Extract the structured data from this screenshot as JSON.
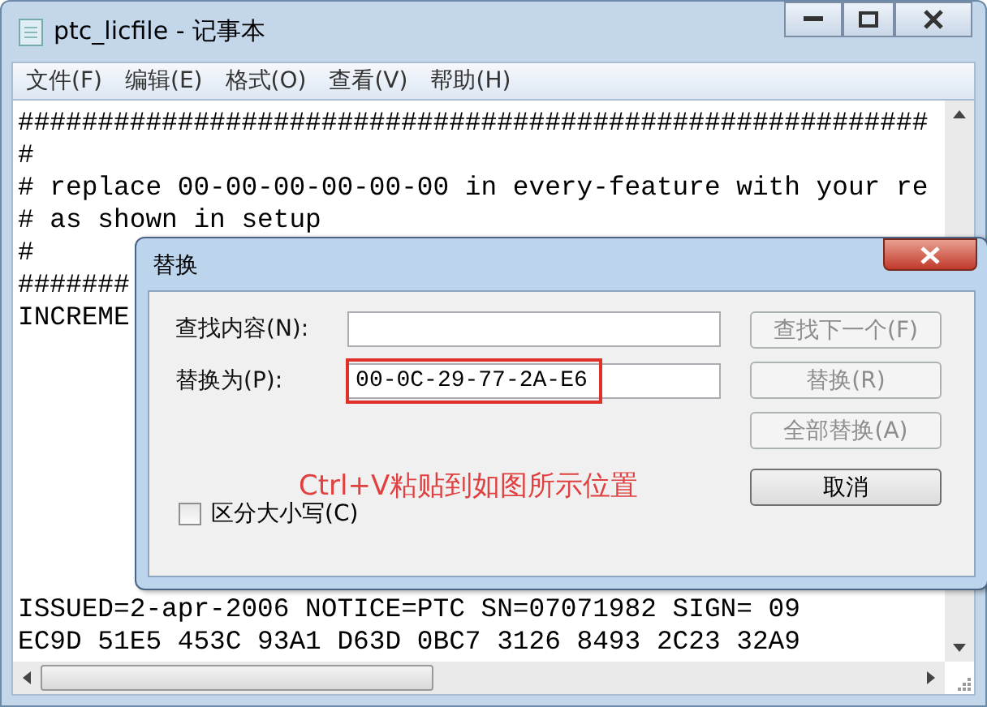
{
  "window": {
    "title": "ptc_licfile - 记事本"
  },
  "menu": [
    {
      "label": "文件(F)"
    },
    {
      "label": "编辑(E)"
    },
    {
      "label": "格式(O)"
    },
    {
      "label": "查看(V)"
    },
    {
      "label": "帮助(H)"
    }
  ],
  "editor": {
    "lines_top": [
      "#########################################################",
      "#",
      "# replace 00-00-00-00-00-00 in every-feature with your re",
      "# as shown in setup",
      "#",
      "#######",
      "INCREME"
    ],
    "lines_bottom": [
      "ISSUED=2-apr-2006 NOTICE=PTC SN=07071982 SIGN= 09",
      "EC9D 51E5 453C 93A1 D63D 0BC7 3126 8493 2C23 32A9"
    ]
  },
  "dialog": {
    "title": "替换",
    "fields": [
      {
        "label": "查找内容(N):",
        "highlighted": false
      },
      {
        "label": "替换为(P):",
        "value": "00-0C-29-77-2A-E6",
        "highlighted": true
      }
    ],
    "buttons": [
      {
        "label": "查找下一个(F)",
        "disabled": true
      },
      {
        "label": "替换(R)",
        "disabled": true
      },
      {
        "label": "全部替换(A)",
        "disabled": true
      },
      {
        "label": "取消",
        "disabled": false
      }
    ],
    "checkbox": {
      "label": "区分大小写(C)",
      "checked": false
    },
    "annotation": "Ctrl+V粘贴到如图所示位置"
  }
}
